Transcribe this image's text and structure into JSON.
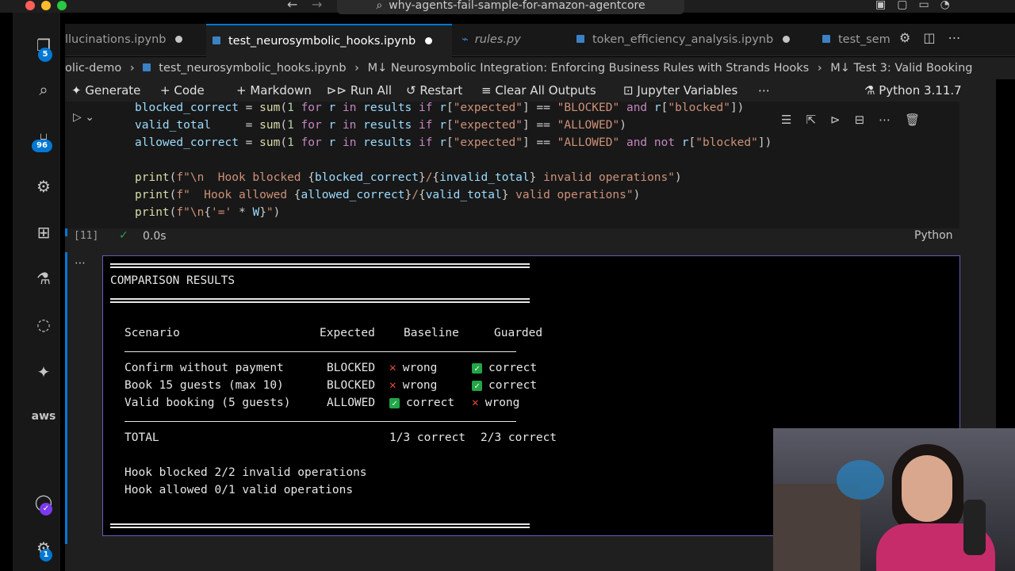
{
  "window": {
    "title": "why-agents-fail-sample-for-amazon-agentcore"
  },
  "activity": {
    "explorer_badge": "5",
    "scm_badge": "96",
    "accounts_badge": "✓",
    "settings_badge": "1",
    "aws_label": "aws"
  },
  "tabs": [
    {
      "label": "llucinations.ipynb",
      "modified": true
    },
    {
      "label": "test_neurosymbolic_hooks.ipynb",
      "modified": true,
      "active": true
    },
    {
      "label": "rules.py",
      "modified": false
    },
    {
      "label": "token_efficiency_analysis.ipynb",
      "modified": true
    },
    {
      "label": "test_sem",
      "modified": false
    }
  ],
  "breadcrumbs": {
    "b1": "olic-demo",
    "b2": "test_neurosymbolic_hooks.ipynb",
    "b3": "Neurosymbolic Integration: Enforcing Business Rules with Strands Hooks",
    "b4": "Test 3: Valid Booking",
    "md_prefix": "M↓"
  },
  "toolbar": {
    "generate": "Generate",
    "code": "Code",
    "markdown": "Markdown",
    "run_all": "Run All",
    "restart": "Restart",
    "clear_outputs": "Clear All Outputs",
    "jupyter_vars": "Jupyter Variables",
    "kernel": "Python 3.11.7"
  },
  "cell": {
    "execution_count": "[11]",
    "duration": "0.0s",
    "language": "Python",
    "lines": [
      "blocked_correct = sum(1 for r in results if r[\"expected\"] == \"BLOCKED\" and r[\"blocked\"])",
      "valid_total     = sum(1 for r in results if r[\"expected\"] == \"ALLOWED\")",
      "allowed_correct = sum(1 for r in results if r[\"expected\"] == \"ALLOWED\" and not r[\"blocked\"])",
      "",
      "print(f\"\\n  Hook blocked {blocked_correct}/{invalid_total} invalid operations\")",
      "print(f\"  Hook allowed {allowed_correct}/{valid_total} valid operations\")",
      "print(f\"\\n{'=' * W}\")"
    ]
  },
  "output": {
    "title": "COMPARISON RESULTS",
    "headers": {
      "scenario": "Scenario",
      "expected": "Expected",
      "baseline": "Baseline",
      "guarded": "Guarded"
    },
    "rows": [
      {
        "scenario": "Confirm without payment",
        "expected": "BLOCKED",
        "baseline": "wrong",
        "baseline_ok": false,
        "guarded": "correct",
        "guarded_ok": true
      },
      {
        "scenario": "Book 15 guests (max 10)",
        "expected": "BLOCKED",
        "baseline": "wrong",
        "baseline_ok": false,
        "guarded": "correct",
        "guarded_ok": true
      },
      {
        "scenario": "Valid booking (5 guests)",
        "expected": "ALLOWED",
        "baseline": "correct",
        "baseline_ok": true,
        "guarded": "wrong",
        "guarded_ok": false
      }
    ],
    "total_label": "TOTAL",
    "total_baseline": "1/3 correct",
    "total_guarded": "2/3 correct",
    "summary_blocked": "Hook blocked 2/2 invalid operations",
    "summary_allowed": "Hook allowed 0/1 valid operations"
  },
  "colors": {
    "accent": "#0078d4",
    "output_border": "#6b5bb5",
    "ok_green": "#22a645",
    "bad_red": "#e8473a"
  }
}
